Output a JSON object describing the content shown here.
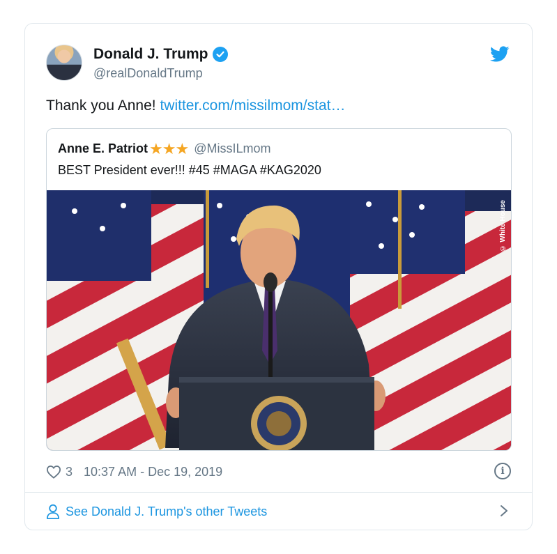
{
  "tweet": {
    "author": {
      "display_name": "Donald J. Trump",
      "handle": "@realDonaldTrump",
      "verified": true
    },
    "text_plain": "Thank you Anne! ",
    "text_link": "twitter.com/missilmom/stat…",
    "likes": "3",
    "timestamp": "10:37 AM - Dec 19, 2019",
    "info_glyph": "i"
  },
  "quote": {
    "name": "Anne E. Patriot",
    "stars": "★★★",
    "handle": "@MissILmom",
    "text": "BEST President ever!!! #45 #MAGA #KAG2020",
    "media_credit": "© White House"
  },
  "footer": {
    "other_tweets_label": "See Donald J. Trump's other Tweets"
  },
  "icons": {
    "brand": "twitter-bird-icon",
    "verified": "verified-badge-icon",
    "like": "heart-icon",
    "info": "info-icon",
    "profile": "person-icon",
    "next": "chevron-right-icon"
  },
  "colors": {
    "accent": "#1da1f2",
    "link": "#1b95e0",
    "muted": "#657786",
    "star": "#f5a623"
  }
}
